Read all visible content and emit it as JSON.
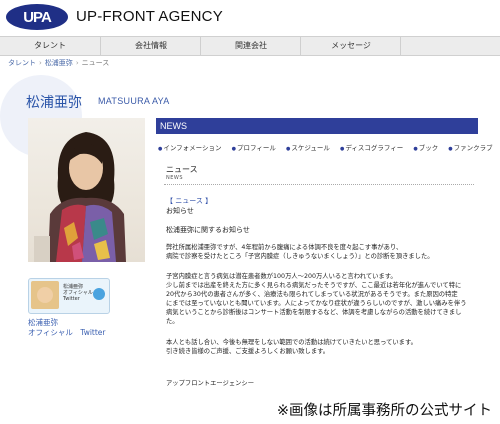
{
  "brand": {
    "badge": "UPA",
    "name": "UP-FRONT AGENCY"
  },
  "nav": [
    "タレント",
    "会社情報",
    "関連会社",
    "メッセージ"
  ],
  "breadcrumb": [
    "タレント",
    "松浦亜弥",
    "ニュース"
  ],
  "artist": {
    "name_jp": "松浦亜弥",
    "name_en": "MATSUURA AYA"
  },
  "twitter": {
    "card_label_line1": "松浦亜弥",
    "card_label_line2": "オフィシャル",
    "card_label_line3": "Twitter",
    "link_line1": "松浦亜弥",
    "link_line2": "オフィシャル　Twitter"
  },
  "news_bar": "NEWS",
  "subnav": [
    "インフォメーション",
    "プロフィール",
    "スケジュール",
    "ディスコグラフィー",
    "ブック",
    "ファンクラブ"
  ],
  "section": {
    "title": "ニュース",
    "subtitle": "NEWS"
  },
  "article": {
    "tag": "【 ニュース 】",
    "headline": "お知らせ",
    "about": "松浦亜弥に関するお知らせ",
    "para1": [
      "弊社所属松浦亜弥ですが、4年程前から腹痛による体調不良を度々起こす事があり、",
      "病院で診察を受けたところ「子宮内膜症（しきゅうないまくしょう）」との診断を頂きました。"
    ],
    "para2": [
      "子宮内膜症と言う病気は潜在患者数が100万人〜200万人いると言われています。",
      "少し前までは出産を終えた方に多く見られる病気だったそうですが、ここ最近は若年化が進んでいて特に",
      "20代から30代の患者さんが多く、治療法も限られてしまっている状況があるそうです。また原因の特定",
      "にまでは至っていないとも聞いています。人によってかなり症状が違うらしいのですが、激しい痛みを伴う",
      "病気ということから診断後はコンサート活動を制限するなど、体調を考慮しながらの活動を続けてきまし",
      "た。"
    ],
    "para3": [
      "本人とも話し合い、今後も無理をしない範囲での活動は続けていきたいと思っています。",
      "引き続き皆様のご声援、ご支援よろしくお願い致します。"
    ],
    "signature": "アップフロントエージェンシー"
  },
  "caption": "※画像は所属事務所の公式サイト"
}
